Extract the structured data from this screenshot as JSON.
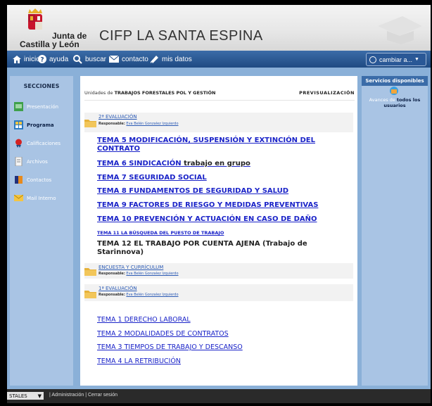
{
  "header": {
    "logo_line1": "Junta de",
    "logo_line2": "Castilla y León",
    "site_title": "CIFP LA SANTA ESPINA"
  },
  "nav": {
    "items": [
      {
        "label": "inicio",
        "icon": "home-icon"
      },
      {
        "label": "ayuda",
        "icon": "help-icon"
      },
      {
        "label": "buscar",
        "icon": "search-icon"
      },
      {
        "label": "contacto",
        "icon": "mail-icon"
      },
      {
        "label": "mis datos",
        "icon": "pencil-icon"
      }
    ],
    "cambiar": "cambiar a..."
  },
  "sidebar": {
    "title": "SECCIONES",
    "items": [
      {
        "label": "Presentación",
        "icon": "presentation-icon"
      },
      {
        "label": "Programa",
        "icon": "program-icon"
      },
      {
        "label": "Calificaciones",
        "icon": "grades-icon"
      },
      {
        "label": "Archivos",
        "icon": "files-icon"
      },
      {
        "label": "Contactos",
        "icon": "contacts-icon"
      },
      {
        "label": "Mail Interno",
        "icon": "mail-internal-icon"
      }
    ]
  },
  "main": {
    "crumb_prefix": "Unidades de",
    "crumb_course": "TRABAJOS FORESTALES POL Y GESTIÓN",
    "preview": "PREVISUALIZACIÓN",
    "sections": [
      {
        "title": "2ª EVALUACIÓN",
        "resp_label": "Responsable:",
        "resp_name": "Eva Belén Gonzalez Izquierdo"
      },
      {
        "title": "ENCUESTA Y CURRÍCULUM",
        "resp_label": "Responsable:",
        "resp_name": "Eva Belén Gonzalez Izquierdo"
      },
      {
        "title": "1ª EVALUACIÓN",
        "resp_label": "Responsable:",
        "resp_name": "Eva Belén Gonzalez Izquierdo"
      }
    ],
    "temas_eval2": [
      "TEMA 5 MODIFICACIÓN, SUSPENSIÓN Y EXTINCIÓN DEL",
      "CONTRATO",
      "TEMA 6 SINDICACIÓN",
      "trabajo en grupo",
      "TEMA 7 SEGURIDAD SOCIAL",
      "TEMA 8 FUNDAMENTOS DE SEGURIDAD Y SALUD",
      "TEMA 9 FACTORES DE RIESGO Y MEDIDAS PREVENTIVAS",
      "TEMA 10 PREVENCIÓN Y ACTUACIÓN EN CASO DE DAÑO",
      "TEMA 11 LA BÚSQUEDA DEL PUESTO DE TRABAJO",
      "TEMA 12 EL TRABAJO POR CUENTA AJENA (Trabajo de",
      "Starinnova)"
    ],
    "temas_eval1": [
      "TEMA 1 DERECHO LABORAL",
      "TEMA 2 MODALIDADES DE CONTRATOS",
      "TEMA 3 TIEMPOS DE TRABAJO Y DESCANSO",
      "TEMA 4 LA RETRIBUCIÓN"
    ]
  },
  "right": {
    "title": "Servicios disponibles",
    "avances_prefix": "Avances de",
    "avances_bold": "todos los usuarios"
  },
  "footer": {
    "select_value": "STALES",
    "links": "| Administración | Cerrar sesión"
  },
  "colors": {
    "nav": "#1f4a82",
    "link": "#1a23c8",
    "side_bg": "#a9c4e4",
    "page_bg": "#8ab0d8"
  }
}
